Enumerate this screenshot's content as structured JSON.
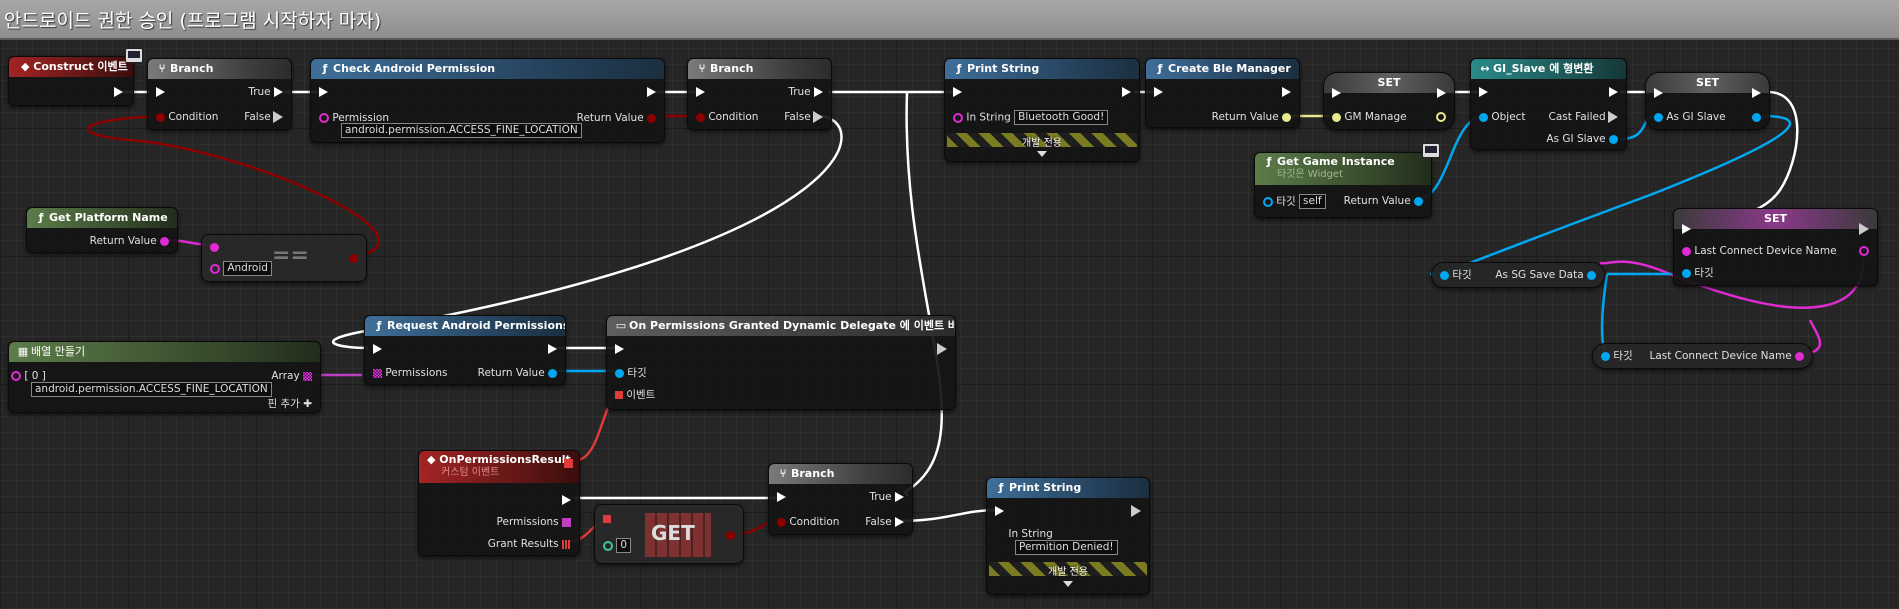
{
  "comment": {
    "title": "안드로이드 권한 승인 (프로그램 시작하자 마자)"
  },
  "colors": {
    "exec": "#ffffff",
    "bool": "#8c0000",
    "string": "#e02ad2",
    "object": "#00a8f2",
    "struct": "#e03a3a",
    "wildcard": "#38c7a0"
  },
  "nodes": {
    "construct": {
      "title": "Construct 이벤트"
    },
    "branch1": {
      "title": "Branch",
      "true": "True",
      "false": "False",
      "condition": "Condition"
    },
    "check_perm": {
      "title": "Check Android Permission",
      "permission": "Permission",
      "permission_value": "android.permission.ACCESS_FINE_LOCATION",
      "return_value": "Return Value"
    },
    "branch2": {
      "title": "Branch",
      "true": "True",
      "false": "False",
      "condition": "Condition"
    },
    "print1": {
      "title": "Print String",
      "in_string": "In String",
      "in_string_value": "Bluetooth Good!",
      "dev_only": "개발 전용"
    },
    "create_ble": {
      "title": "Create Ble Manager",
      "return_value": "Return Value"
    },
    "set_gm": {
      "title": "SET",
      "var": "GM Manage"
    },
    "cast": {
      "title": "GI_Slave 에 형변환",
      "object": "Object",
      "cast_failed": "Cast Failed",
      "as_gi_slave": "As GI Slave"
    },
    "set_gi": {
      "title": "SET",
      "var": "As GI Slave"
    },
    "get_game_instance": {
      "title": "Get Game Instance",
      "subtitle": "타깃은 Widget",
      "target": "타깃",
      "target_value": "self",
      "return_value": "Return Value"
    },
    "get_platform": {
      "title": "Get Platform Name",
      "return_value": "Return Value"
    },
    "equals": {
      "symbol": "==",
      "value": "Android"
    },
    "make_array": {
      "title": "배열 만들기",
      "index": "[ 0 ]",
      "value": "android.permission.ACCESS_FINE_LOCATION",
      "array": "Array",
      "add_pin": "핀 추가"
    },
    "request_perm": {
      "title": "Request Android Permissions",
      "permissions": "Permissions",
      "return_value": "Return Value"
    },
    "bind_delegate": {
      "title": "On Permissions Granted Dynamic Delegate 에 이벤트 바인딩",
      "target": "타깃",
      "event": "이벤트"
    },
    "on_result": {
      "title": "OnPermissionsResult",
      "subtitle": "커스텀 이벤트",
      "permissions": "Permissions",
      "grant_results": "Grant Results"
    },
    "get": {
      "title": "GET",
      "index_value": "0"
    },
    "branch3": {
      "title": "Branch",
      "true": "True",
      "false": "False",
      "condition": "Condition"
    },
    "print2": {
      "title": "Print String",
      "in_string": "In String",
      "in_string_value": "Permition Denied!",
      "dev_only": "개발 전용"
    },
    "set_last": {
      "title": "SET",
      "var": "Last Connect Device Name",
      "target": "타깃"
    },
    "as_sg_save": {
      "target": "타깃",
      "label": "As SG Save Data"
    },
    "get_last": {
      "target": "타깃",
      "label": "Last Connect Device Name"
    }
  }
}
